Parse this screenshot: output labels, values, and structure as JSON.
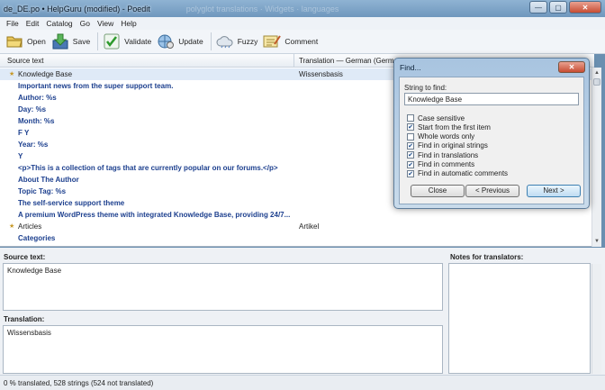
{
  "window": {
    "title": "de_DE.po • HelpGuru (modified) - Poedit",
    "blurred_tabs": "polyglot translations  ·  Widgets  ·  languages",
    "minimize_glyph": "—",
    "maximize_glyph": "▢",
    "close_glyph": "✕"
  },
  "menu": [
    "File",
    "Edit",
    "Catalog",
    "Go",
    "View",
    "Help"
  ],
  "toolbar": {
    "open": "Open",
    "save": "Save",
    "validate": "Validate",
    "update": "Update",
    "fuzzy": "Fuzzy",
    "comment": "Comment"
  },
  "list": {
    "col_source": "Source text",
    "col_translation": "Translation — German (Germany)",
    "rows": [
      {
        "source": "Knowledge Base",
        "translation": "Wissensbasis",
        "style": "normal",
        "star": true
      },
      {
        "source": "Important news from the super support team.",
        "translation": "",
        "style": "bold",
        "star": false
      },
      {
        "source": "Author: %s",
        "translation": "",
        "style": "bold",
        "star": false
      },
      {
        "source": "Day: %s",
        "translation": "",
        "style": "bold",
        "star": false
      },
      {
        "source": "Month: %s",
        "translation": "",
        "style": "bold",
        "star": false
      },
      {
        "source": "F Y",
        "translation": "",
        "style": "bold",
        "star": false
      },
      {
        "source": "Year: %s",
        "translation": "",
        "style": "bold",
        "star": false
      },
      {
        "source": "Y",
        "translation": "",
        "style": "bold",
        "star": false
      },
      {
        "source": "<p>This is a collection of tags that are currently popular on our forums.</p>",
        "translation": "",
        "style": "bold",
        "star": false
      },
      {
        "source": "About The Author",
        "translation": "",
        "style": "bold",
        "star": false
      },
      {
        "source": "Topic Tag: %s",
        "translation": "",
        "style": "bold",
        "star": false
      },
      {
        "source": "The self-service support theme",
        "translation": "",
        "style": "bold",
        "star": false
      },
      {
        "source": "A premium WordPress theme with integrated Knowledge Base, providing 24/7...",
        "translation": "",
        "style": "bold",
        "star": false
      },
      {
        "source": "Articles",
        "translation": "Artikel",
        "style": "normal",
        "star": true
      },
      {
        "source": "Categories",
        "translation": "",
        "style": "bold",
        "star": false
      }
    ]
  },
  "panels": {
    "source_label": "Source text:",
    "source_value": "Knowledge Base",
    "translation_label": "Translation:",
    "translation_value": "Wissensbasis",
    "notes_label": "Notes for translators:"
  },
  "status": "0 % translated, 528 strings (524 not translated)",
  "find_dialog": {
    "title": "Find...",
    "close_glyph": "✕",
    "string_label": "String to find:",
    "string_value": "Knowledge Base",
    "options": [
      {
        "label": "Case sensitive",
        "checked": false
      },
      {
        "label": "Start from the first item",
        "checked": true
      },
      {
        "label": "Whole words only",
        "checked": false
      },
      {
        "label": "Find in original strings",
        "checked": true
      },
      {
        "label": "Find in translations",
        "checked": true
      },
      {
        "label": "Find in comments",
        "checked": true
      },
      {
        "label": "Find in automatic comments",
        "checked": true
      }
    ],
    "close_button": "Close",
    "previous_button": "< Previous",
    "next_button": "Next >"
  },
  "colors": {
    "accent": "#1c3f8e",
    "title_bar": "#7fa5c9",
    "dialog_frame": "#b8cfe6"
  }
}
